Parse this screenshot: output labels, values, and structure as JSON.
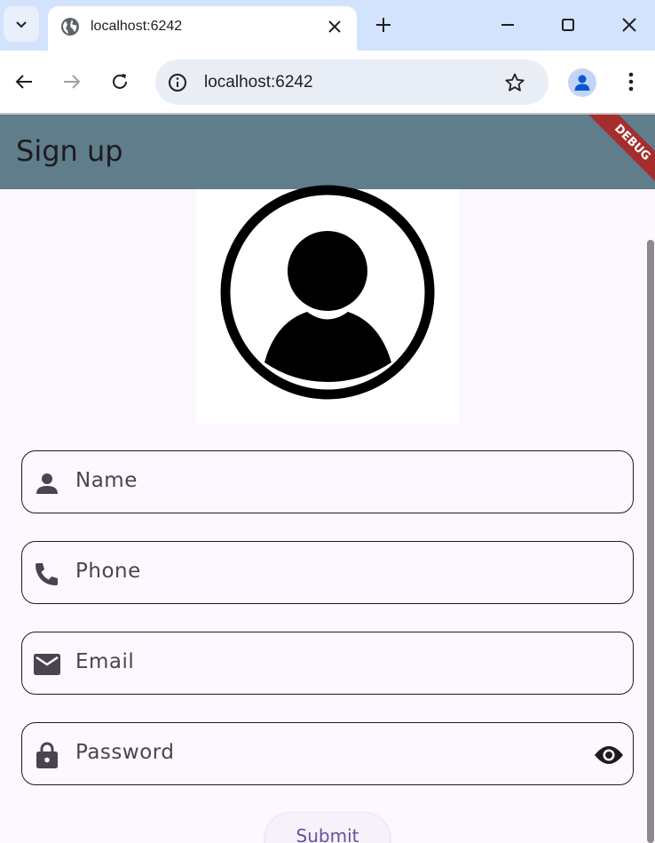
{
  "browser": {
    "tab_title": "localhost:6242",
    "url": "localhost:6242"
  },
  "app": {
    "title": "Sign up",
    "debug_banner": "DEBUG",
    "colors": {
      "appbar": "#607d8b",
      "background": "#fdf7ff",
      "primary": "#6750a4",
      "debug_banner": "#a42e2e"
    }
  },
  "form": {
    "fields": [
      {
        "label": "Name",
        "icon": "person-icon"
      },
      {
        "label": "Phone",
        "icon": "phone-icon"
      },
      {
        "label": "Email",
        "icon": "mail-icon"
      },
      {
        "label": "Password",
        "icon": "lock-icon",
        "suffix_icon": "visibility-icon"
      }
    ],
    "submit_label": "Submit"
  }
}
